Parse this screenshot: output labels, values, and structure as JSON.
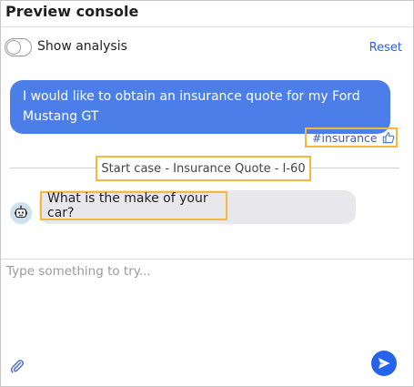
{
  "header": {
    "title": "Preview console"
  },
  "controls": {
    "toggle_label": "Show analysis",
    "toggle_on": false,
    "reset_label": "Reset"
  },
  "messages": {
    "user": "I would like to obtain an insurance quote for my Ford Mustang GT",
    "intent_tag": "#insurance",
    "case_label": "Start case - Insurance Quote - I-60",
    "bot": "What is the make of your car?"
  },
  "composer": {
    "placeholder": "Type something to try..."
  },
  "colors": {
    "accent": "#2563eb",
    "user_bubble": "#4b7ee8",
    "highlight": "#f6b73c",
    "bot_bubble": "#e8e8ec"
  },
  "icons": [
    "thumbs-up-icon",
    "bot-avatar-icon",
    "paperclip-icon",
    "send-icon"
  ]
}
